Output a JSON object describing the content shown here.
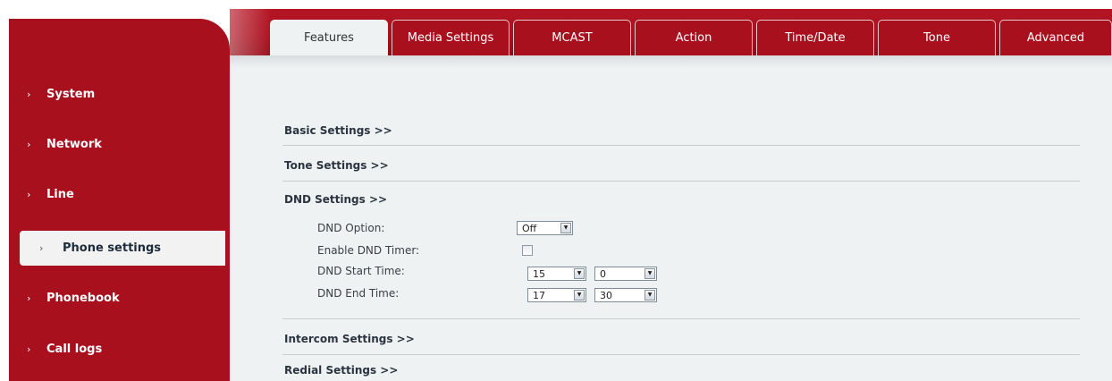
{
  "tabs": [
    {
      "label": "Features",
      "active": true
    },
    {
      "label": "Media Settings",
      "active": false
    },
    {
      "label": "MCAST",
      "active": false
    },
    {
      "label": "Action",
      "active": false
    },
    {
      "label": "Time/Date",
      "active": false
    },
    {
      "label": "Tone",
      "active": false
    },
    {
      "label": "Advanced",
      "active": false
    }
  ],
  "sidebar": {
    "chevron": "›",
    "items": [
      {
        "label": "System"
      },
      {
        "label": "Network"
      },
      {
        "label": "Line"
      },
      {
        "label": "Phone settings",
        "active": true
      },
      {
        "label": "Phonebook"
      },
      {
        "label": "Call logs"
      }
    ]
  },
  "sections": {
    "basic": "Basic Settings >>",
    "tone": "Tone Settings >>",
    "dnd": "DND Settings >>",
    "intercom": "Intercom Settings >>",
    "redial": "Redial Settings >>"
  },
  "dnd": {
    "option_label": "DND Option:",
    "option_value": "Off",
    "timer_label": "Enable DND Timer:",
    "timer_checked": false,
    "start_label": "DND Start Time:",
    "start_hour": "15",
    "start_minute": "0",
    "end_label": "DND End Time:",
    "end_hour": "17",
    "end_minute": "30"
  },
  "colors": {
    "brand_red": "#a8101e",
    "content_bg": "#eef2f3"
  },
  "icons": {
    "dropdown": "chevron-down-icon",
    "nav": "chevron-right-icon"
  }
}
